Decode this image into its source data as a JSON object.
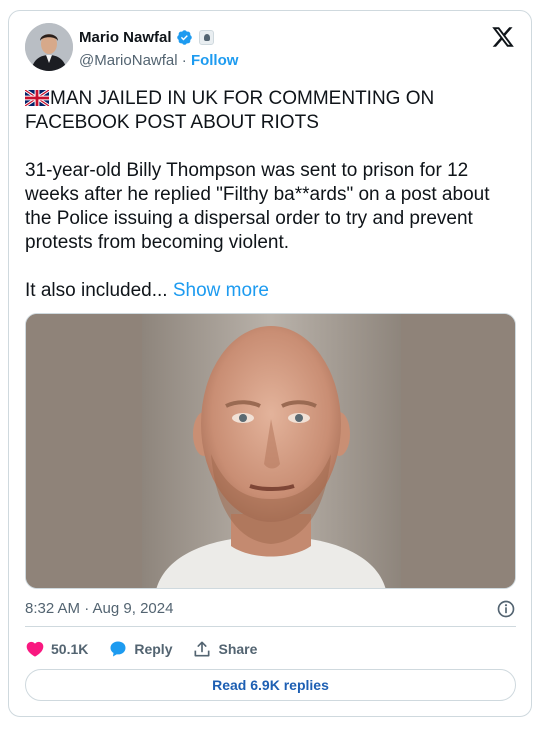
{
  "author": {
    "display_name": "Mario Nawfal",
    "handle": "@MarioNawfal",
    "separator": " · ",
    "follow_label": "Follow"
  },
  "tweet": {
    "headline": "MAN JAILED IN UK FOR COMMENTING ON FACEBOOK POST ABOUT RIOTS",
    "body": "31-year-old Billy Thompson was sent to prison for 12 weeks after he replied \"Filthy ba**ards\" on a post about the Police issuing a dispersal order to try and prevent protests from becoming violent.",
    "truncated": "It also included... ",
    "show_more_label": "Show more",
    "flag_icon": "uk-flag-icon"
  },
  "meta": {
    "timestamp": "8:32 AM · Aug 9, 2024"
  },
  "actions": {
    "likes": "50.1K",
    "reply_label": "Reply",
    "share_label": "Share"
  },
  "footer": {
    "read_replies_label": "Read 6.9K replies"
  },
  "colors": {
    "accent": "#1d9bf0",
    "like": "#f91880",
    "text": "#0f1419",
    "muted": "#536471",
    "border": "#cfd9de"
  }
}
